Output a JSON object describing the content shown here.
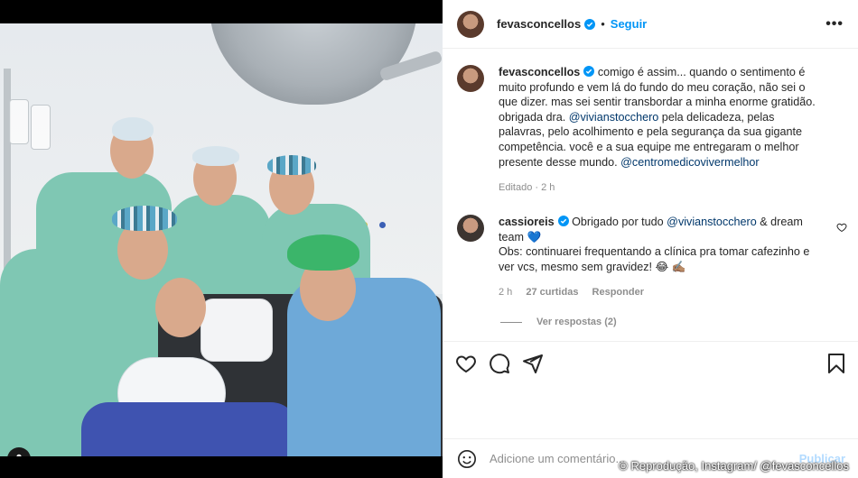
{
  "post": {
    "username": "fevasconcellos",
    "follow_label": "Seguir",
    "more_label": "•••",
    "caption_username": "fevasconcellos",
    "caption_parts": [
      "comigo é assim... quando o sentimento é muito profundo e vem lá do fundo do meu coração, não sei o que dizer. mas sei sentir transbordar a minha enorme gratidão. obrigada dra. ",
      "@vivianstocchero",
      " pela delicadeza, pelas palavras, pelo acolhimento e pela segurança da sua gigante competência. você e a sua equipe me entregaram o melhor presente desse mundo. ",
      "@centromedicovivermelhor"
    ],
    "caption_meta": "Editado · 2 h"
  },
  "comment": {
    "username": "cassioreis",
    "text_parts": [
      "Obrigado por tudo ",
      "@vivianstocchero",
      " & dream team 💙",
      "Obs: continuarei frequentando a clínica pra tomar cafezinho e ver vcs, mesmo sem gravidez! 😂 ✍🏽"
    ],
    "time": "2 h",
    "likes": "27 curtidas",
    "reply": "Responder",
    "view_replies": "Ver respostas (2)"
  },
  "composer": {
    "placeholder": "Adicione um comentário...",
    "post_label": "Publicar"
  },
  "credit": "© Reprodução, Instagram/ @fevasconcellos",
  "icons": [
    "heart-icon",
    "comment-icon",
    "share-icon",
    "bookmark-icon",
    "emoji-icon",
    "tag-user-icon",
    "verified-icon"
  ],
  "colors": {
    "link": "#0095f6",
    "mention": "#00376b",
    "muted": "#8e8e8e",
    "verified": "#0095f6"
  }
}
